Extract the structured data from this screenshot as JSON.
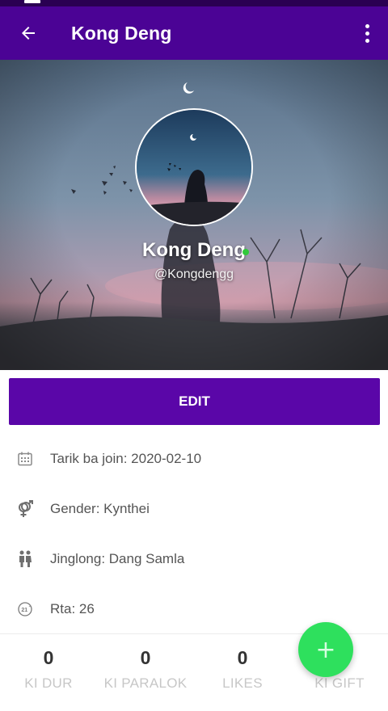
{
  "status_bar": {
    "text": "ᴬ ᵗ"
  },
  "app_bar": {
    "title": "Kong Deng",
    "back_icon": "arrow-left-icon",
    "menu_icon": "more-vert-icon",
    "color": "#4b0395"
  },
  "profile": {
    "name": "Kong Deng",
    "handle": "@Kongdengg",
    "online": true,
    "online_color": "#31c93b"
  },
  "edit_button": {
    "label": "EDIT",
    "color": "#5a06a8"
  },
  "info": [
    {
      "icon": "calendar-icon",
      "text": "Tarik ba join: 2020-02-10"
    },
    {
      "icon": "gender-icon",
      "text": "Gender: Kynthei"
    },
    {
      "icon": "couple-icon",
      "text": "Jinglong: Dang Samla"
    },
    {
      "icon": "age-21-icon",
      "icon_text": "21",
      "text": "Rta: 26"
    }
  ],
  "stats": [
    {
      "count": "0",
      "label": "KI DUR"
    },
    {
      "count": "0",
      "label": "KI PARALOK"
    },
    {
      "count": "0",
      "label": "LIKES"
    },
    {
      "count": "",
      "label": "KI GIFT"
    }
  ],
  "fab": {
    "label": "+",
    "icon": "add-icon",
    "color": "#2ee05d"
  }
}
